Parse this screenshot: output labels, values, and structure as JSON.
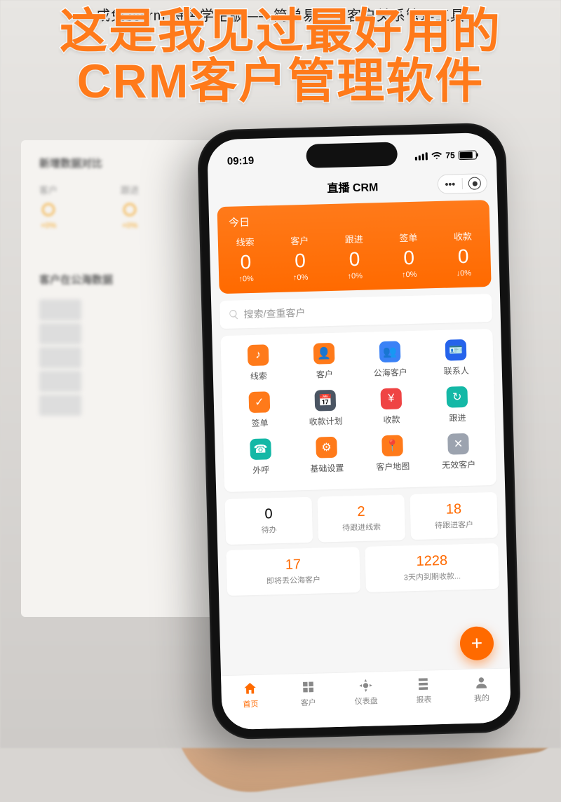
{
  "overlay": {
    "caption": "成免费crm 特色学生版——简单易用的客户关系管理工具",
    "title_line1": "这是我见过最好用的",
    "title_line2": "CRM客户管理软件"
  },
  "bg": {
    "section1_title": "新增数据对比",
    "stats": [
      {
        "label": "客户",
        "pct": "+0%"
      },
      {
        "label": "跟进",
        "pct": "+0%"
      }
    ],
    "section2_title": "客户在公海数据"
  },
  "status": {
    "time": "09:19",
    "battery": "75"
  },
  "header": {
    "title": "直播 CRM"
  },
  "today": {
    "label": "今日",
    "cols": [
      {
        "name": "线索",
        "val": "0",
        "pct": "↑0%"
      },
      {
        "name": "客户",
        "val": "0",
        "pct": "↑0%"
      },
      {
        "name": "跟进",
        "val": "0",
        "pct": "↑0%"
      },
      {
        "name": "签单",
        "val": "0",
        "pct": "↑0%"
      },
      {
        "name": "收款",
        "val": "0",
        "pct": "↓0%"
      }
    ]
  },
  "search": {
    "placeholder": "搜索/查重客户"
  },
  "grid": [
    {
      "label": "线索",
      "color": "c-orange",
      "glyph": "♪"
    },
    {
      "label": "客户",
      "color": "c-orange",
      "glyph": "👤"
    },
    {
      "label": "公海客户",
      "color": "c-blue",
      "glyph": "👥"
    },
    {
      "label": "联系人",
      "color": "c-dblue",
      "glyph": "🪪"
    },
    {
      "label": "签单",
      "color": "c-orange",
      "glyph": "✓"
    },
    {
      "label": "收款计划",
      "color": "c-navy",
      "glyph": "📅"
    },
    {
      "label": "收款",
      "color": "c-red",
      "glyph": "¥"
    },
    {
      "label": "跟进",
      "color": "c-teal",
      "glyph": "↻"
    },
    {
      "label": "外呼",
      "color": "c-teal",
      "glyph": "☎"
    },
    {
      "label": "基础设置",
      "color": "c-orange",
      "glyph": "⚙"
    },
    {
      "label": "客户地图",
      "color": "c-loc",
      "glyph": "📍"
    },
    {
      "label": "无效客户",
      "color": "c-grey",
      "glyph": "✕"
    }
  ],
  "todos": [
    {
      "num": "0",
      "label": "待办",
      "hot": false,
      "wide": false
    },
    {
      "num": "2",
      "label": "待跟进线索",
      "hot": true,
      "wide": false
    },
    {
      "num": "18",
      "label": "待跟进客户",
      "hot": true,
      "wide": false
    },
    {
      "num": "17",
      "label": "即将丢公海客户",
      "hot": true,
      "wide": true
    },
    {
      "num": "1228",
      "label": "3天内到期收款...",
      "hot": true,
      "wide": true
    }
  ],
  "fab": {
    "glyph": "+"
  },
  "tabs": [
    {
      "label": "首页",
      "active": true
    },
    {
      "label": "客户",
      "active": false
    },
    {
      "label": "仪表盘",
      "active": false
    },
    {
      "label": "报表",
      "active": false
    },
    {
      "label": "我的",
      "active": false
    }
  ]
}
